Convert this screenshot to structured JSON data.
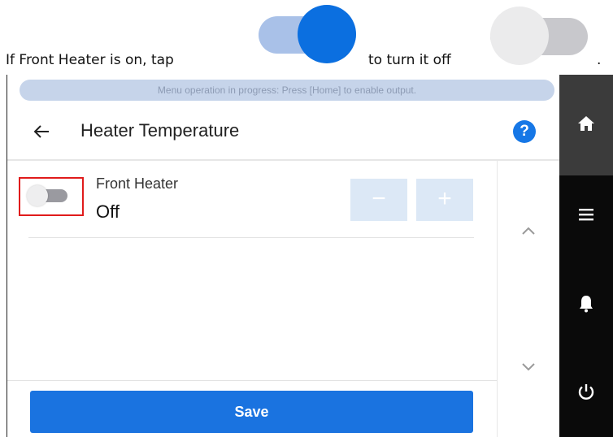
{
  "instruction": {
    "part1": "If Front Heater is on, tap",
    "part2": "to turn it off",
    "part3": "."
  },
  "status_banner": "Menu operation in progress: Press [Home] to enable output.",
  "header": {
    "title": "Heater Temperature",
    "help_label": "?"
  },
  "heater": {
    "label": "Front Heater",
    "value": "Off",
    "minus_label": "−",
    "plus_label": "+"
  },
  "save_label": "Save",
  "icons": {
    "back": "arrow-left-icon",
    "help": "question-icon",
    "home": "home-icon",
    "menu": "hamburger-menu-icon",
    "notifications": "bell-icon",
    "power": "power-icon",
    "scroll_up": "chevron-up-icon",
    "scroll_down": "chevron-down-icon"
  },
  "colors": {
    "accent": "#1a73e0",
    "toggle_on": "#0b6fe0",
    "highlight": "#e01b1b",
    "nav_background": "#0a0a0a"
  }
}
